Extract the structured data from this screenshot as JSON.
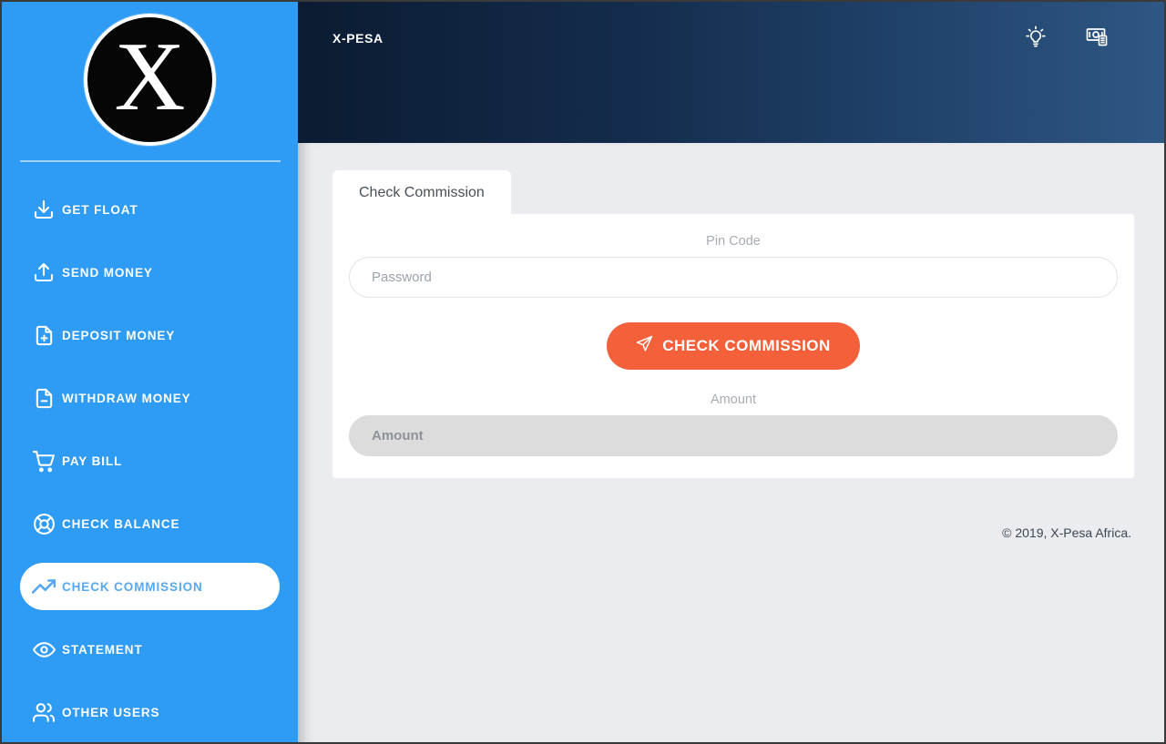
{
  "app": {
    "brand": "X-PESA",
    "logo_letter": "X",
    "sidebar_color": "#2e9bf5",
    "accent_color": "#f4603a",
    "header_gradient_from": "#0b1b31",
    "header_gradient_to": "#2e5783"
  },
  "sidebar": {
    "items": [
      {
        "label": "GET FLOAT",
        "icon": "download-icon",
        "active": false
      },
      {
        "label": "SEND MONEY",
        "icon": "upload-icon",
        "active": false
      },
      {
        "label": "DEPOSIT MONEY",
        "icon": "file-plus-icon",
        "active": false
      },
      {
        "label": "WITHDRAW MONEY",
        "icon": "file-minus-icon",
        "active": false
      },
      {
        "label": "PAY BILL",
        "icon": "shopping-cart-icon",
        "active": false
      },
      {
        "label": "CHECK BALANCE",
        "icon": "life-buoy-icon",
        "active": false
      },
      {
        "label": "CHECK COMMISSION",
        "icon": "trending-up-icon",
        "active": true
      },
      {
        "label": "STATEMENT",
        "icon": "eye-icon",
        "active": false
      },
      {
        "label": "OTHER USERS",
        "icon": "users-icon",
        "active": false
      }
    ]
  },
  "header": {
    "title": "X-PESA",
    "actions": [
      {
        "name": "lightbulb-icon"
      },
      {
        "name": "money-icon"
      }
    ]
  },
  "main": {
    "tabs": [
      {
        "label": "Check Commission",
        "active": true
      }
    ],
    "form": {
      "pin_label": "Pin Code",
      "pin_placeholder": "Password",
      "pin_value": "",
      "submit_label": "CHECK COMMISSION",
      "submit_icon": "send-icon",
      "amount_label": "Amount",
      "amount_placeholder": "Amount",
      "amount_value": "",
      "amount_disabled": true
    }
  },
  "footer": {
    "copyright": "© 2019, X-Pesa Africa."
  }
}
